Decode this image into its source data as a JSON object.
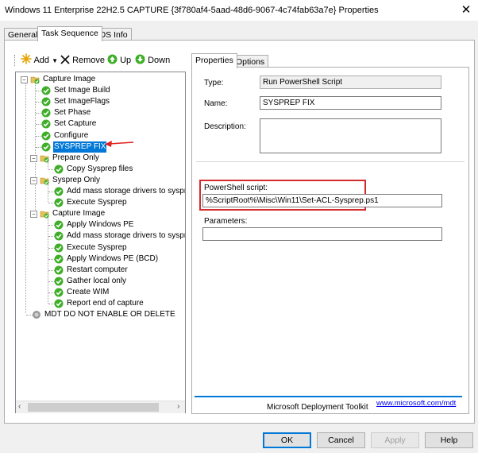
{
  "window": {
    "title": "Windows 11 Enterprise 22H2.5 CAPTURE {3f780af4-5aad-48d6-9067-4c74fab63a7e} Properties",
    "close_glyph": "✕"
  },
  "tabs": [
    {
      "label": "General"
    },
    {
      "label": "Task Sequence",
      "active": true
    },
    {
      "label": "OS Info"
    }
  ],
  "toolbar": {
    "add": "Add",
    "remove": "Remove",
    "up": "Up",
    "down": "Down",
    "add_icon": "sparkle-icon",
    "remove_icon": "x-icon",
    "up_icon": "green-up-arrow-icon",
    "down_icon": "green-down-arrow-icon"
  },
  "tree": [
    {
      "label": "Capture Image",
      "type": "group",
      "level": 0,
      "expanded": true
    },
    {
      "label": "Set Image Build",
      "type": "step",
      "level": 1
    },
    {
      "label": "Set ImageFlags",
      "type": "step",
      "level": 1
    },
    {
      "label": "Set Phase",
      "type": "step",
      "level": 1
    },
    {
      "label": "Set Capture",
      "type": "step",
      "level": 1
    },
    {
      "label": "Configure",
      "type": "step",
      "level": 1
    },
    {
      "label": "SYSPREP FIX",
      "type": "step",
      "level": 1,
      "selected": true
    },
    {
      "label": "Prepare Only",
      "type": "group",
      "level": 1,
      "expanded": true
    },
    {
      "label": "Copy Sysprep files",
      "type": "step",
      "level": 2
    },
    {
      "label": "Sysprep Only",
      "type": "group",
      "level": 1,
      "expanded": true
    },
    {
      "label": "Add mass storage drivers to sysprep.ir",
      "type": "step",
      "level": 2
    },
    {
      "label": "Execute Sysprep",
      "type": "step",
      "level": 2
    },
    {
      "label": "Capture Image",
      "type": "group",
      "level": 1,
      "expanded": true
    },
    {
      "label": "Apply Windows PE",
      "type": "step",
      "level": 2
    },
    {
      "label": "Add mass storage drivers to sysprep.ir",
      "type": "step",
      "level": 2
    },
    {
      "label": "Execute Sysprep",
      "type": "step",
      "level": 2
    },
    {
      "label": "Apply Windows PE (BCD)",
      "type": "step",
      "level": 2
    },
    {
      "label": "Restart computer",
      "type": "step",
      "level": 2
    },
    {
      "label": "Gather local only",
      "type": "step",
      "level": 2
    },
    {
      "label": "Create WIM",
      "type": "step",
      "level": 2
    },
    {
      "label": "Report end of capture",
      "type": "step",
      "level": 2
    },
    {
      "label": "MDT DO NOT ENABLE OR DELETE",
      "type": "disabled",
      "level": 0
    }
  ],
  "inner_tabs": [
    {
      "label": "Properties",
      "active": true
    },
    {
      "label": "Options"
    }
  ],
  "properties": {
    "type_label": "Type:",
    "type_value": "Run PowerShell Script",
    "name_label": "Name:",
    "name_value": "SYSPREP FIX",
    "description_label": "Description:",
    "description_value": "",
    "script_label": "PowerShell script:",
    "script_value": "%ScriptRoot%\\Misc\\Win11\\Set-ACL-Sysprep.ps1",
    "parameters_label": "Parameters:",
    "parameters_value": ""
  },
  "footer": {
    "brand": "Microsoft Deployment Toolkit",
    "link": "www.microsoft.com/mdt"
  },
  "buttons": {
    "ok": "OK",
    "cancel": "Cancel",
    "apply": "Apply",
    "help": "Help"
  },
  "colors": {
    "selection": "#0078d7",
    "highlight_box": "#d42c2c",
    "arrow": "#e02020",
    "link": "#0000ee",
    "step_icon": "#3fae29",
    "folder_icon": "#e8c15a"
  }
}
